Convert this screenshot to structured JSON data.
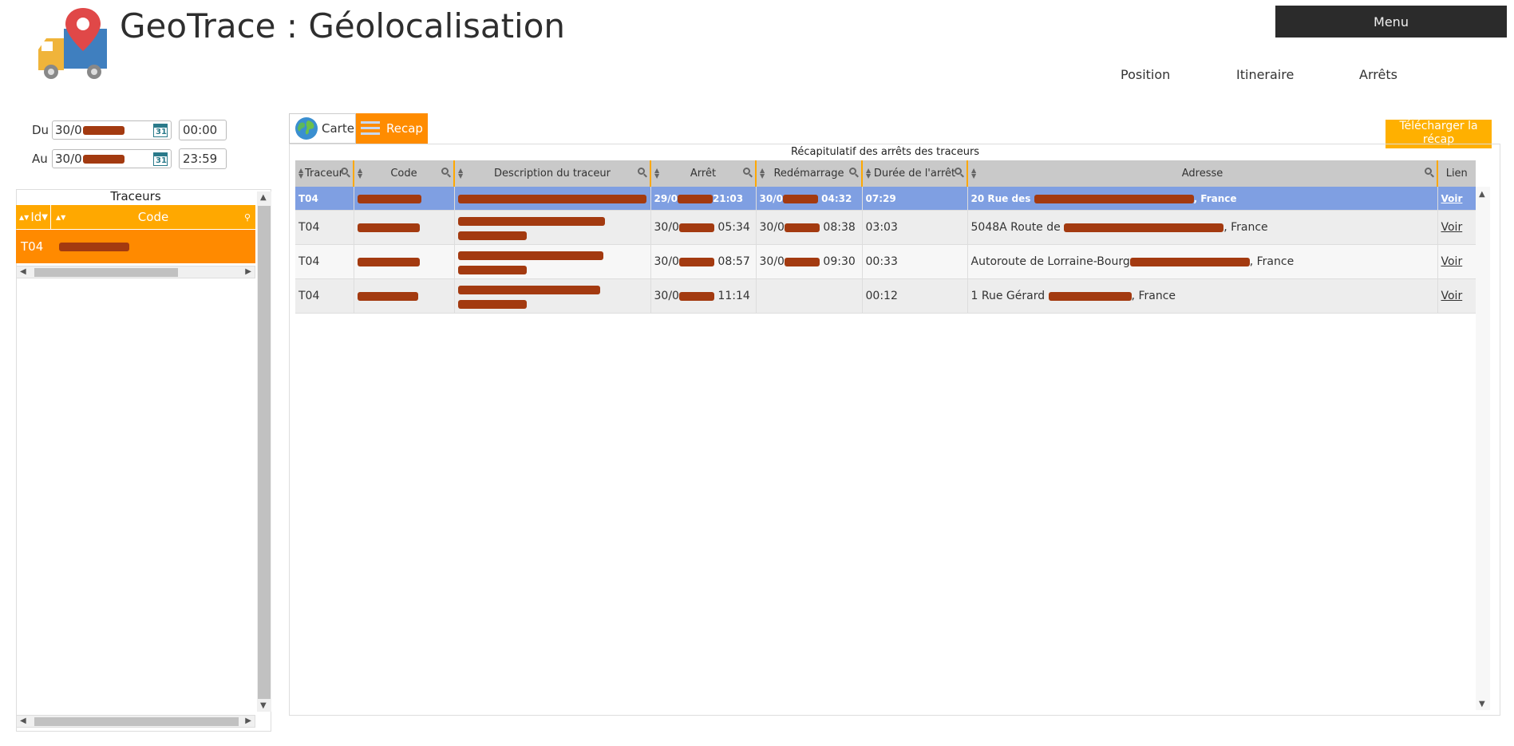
{
  "header": {
    "title": "GeoTrace : Géolocalisation",
    "menu_label": "Menu",
    "nav": [
      {
        "label": "Position"
      },
      {
        "label": "Itineraire"
      },
      {
        "label": "Arrêts"
      }
    ]
  },
  "filters": {
    "from_label": "Du",
    "from_date": "30/0",
    "from_time": "00:00",
    "to_label": "Au",
    "to_date": "30/0",
    "to_time": "23:59",
    "calendar_day": "31"
  },
  "tracers": {
    "title": "Traceurs",
    "col_id": "Id",
    "col_code": "Code",
    "rows": [
      {
        "id": "T04"
      }
    ]
  },
  "tabs": {
    "carte": "Carte",
    "recap": "Recap"
  },
  "download_label": "Télécharger la récap",
  "recap": {
    "caption": "Récapitulatif des arrêts des traceurs",
    "columns": [
      "Traceur",
      "Code",
      "Description du traceur",
      "Arrêt",
      "Redémarrage",
      "Durée de l'arrêt",
      "Adresse",
      "Lien"
    ],
    "rows": [
      {
        "traceur": "T04",
        "arret_a": "29/0",
        "arret_b": "21:03",
        "redem_a": "30/0",
        "redem_b": "04:32",
        "duree": "07:29",
        "adresse_a": "20 Rue des",
        "adresse_b": ", France",
        "lien": "Voir"
      },
      {
        "traceur": "T04",
        "arret_a": "30/0",
        "arret_b": "05:34",
        "redem_a": "30/0",
        "redem_b": "08:38",
        "duree": "03:03",
        "adresse_a": "5048A Route de",
        "adresse_b": ", France",
        "lien": "Voir"
      },
      {
        "traceur": "T04",
        "arret_a": "30/0",
        "arret_b": "08:57",
        "redem_a": "30/0",
        "redem_b": "09:30",
        "duree": "00:33",
        "adresse_a": "Autoroute de Lorraine-Bourg",
        "adresse_b": ", France",
        "lien": "Voir"
      },
      {
        "traceur": "T04",
        "arret_a": "30/0",
        "arret_b": "11:14",
        "redem_a": "",
        "redem_b": "",
        "duree": "00:12",
        "adresse_a": "1 Rue Gérard",
        "adresse_b": ", France",
        "lien": "Voir"
      }
    ]
  },
  "colors": {
    "accent_orange": "#ff8c00",
    "header_orange": "#ffa800",
    "selected_row": "#7f9fe2",
    "menu_bg": "#2b2b2b"
  }
}
